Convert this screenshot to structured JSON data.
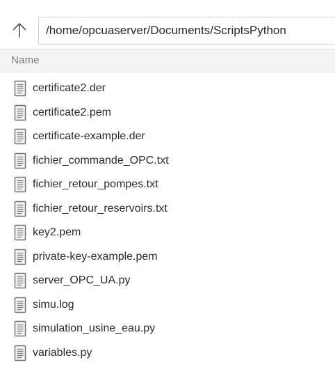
{
  "toolbar": {
    "up_icon": "arrow-up-icon",
    "path": "/home/opcuaserver/Documents/ScriptsPython"
  },
  "list": {
    "column_header": "Name",
    "file_icon": "text-file-icon",
    "files": [
      "certificate2.der",
      "certificate2.pem",
      "certificate-example.der",
      "fichier_commande_OPC.txt",
      "fichier_retour_pompes.txt",
      "fichier_retour_reservoirs.txt",
      "key2.pem",
      "private-key-example.pem",
      "server_OPC_UA.py",
      "simu.log",
      "simulation_usine_eau.py",
      "variables.py"
    ]
  },
  "colors": {
    "header_background": "#f4f4f4",
    "border": "#cfcfcf",
    "text": "#2b2b2b",
    "muted_text": "#7a7a7a"
  }
}
